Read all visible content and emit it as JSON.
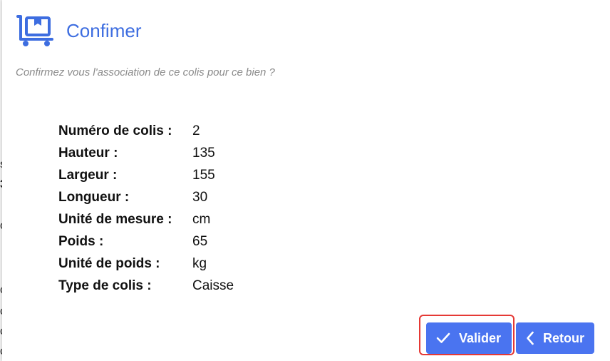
{
  "dialog": {
    "title": "Confimer",
    "subtitle": "Confirmez vous l'association de ce colis pour ce bien ?",
    "header_icon": "package-cart-icon",
    "accent_color": "#3d6de0"
  },
  "details": [
    {
      "label": "Numéro de colis :",
      "value": "2"
    },
    {
      "label": "Hauteur :",
      "value": "135"
    },
    {
      "label": "Largeur :",
      "value": "155"
    },
    {
      "label": "Longueur :",
      "value": "30"
    },
    {
      "label": "Unité de mesure :",
      "value": "cm"
    },
    {
      "label": "Poids :",
      "value": "65"
    },
    {
      "label": "Unité de poids :",
      "value": "kg"
    },
    {
      "label": "Type de colis :",
      "value": "Caisse"
    }
  ],
  "buttons": {
    "validate_label": "Valider",
    "validate_icon": "check-icon",
    "back_label": "Retour",
    "back_icon": "chevron-left-icon",
    "button_color": "#4a74f0",
    "highlight_color": "#e53935"
  },
  "background": {
    "glyphs": [
      "s",
      "3",
      "o",
      "c",
      "c",
      "c",
      "c"
    ]
  }
}
